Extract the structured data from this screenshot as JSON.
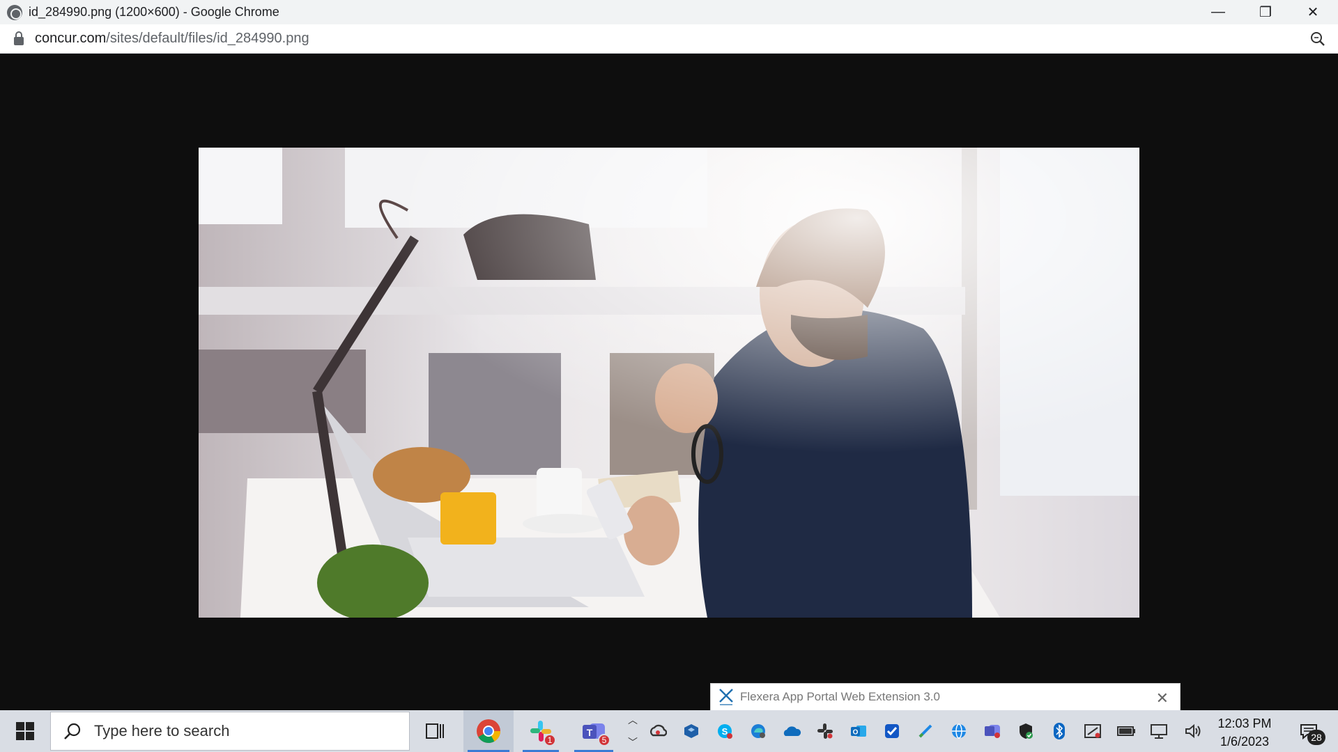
{
  "window": {
    "title": "id_284990.png (1200×600) - Google Chrome",
    "controls": {
      "minimize": "—",
      "maximize": "❐",
      "close": "✕"
    }
  },
  "address": {
    "domain": "concur.com",
    "path": "/sites/default/files/id_284990.png"
  },
  "content": {
    "image_alt": "id_284990.png"
  },
  "notification": {
    "text": "Flexera App Portal Web Extension 3.0",
    "close": "✕"
  },
  "taskbar": {
    "search_placeholder": "Type here to search",
    "apps": [
      {
        "name": "task-view-icon"
      },
      {
        "name": "chrome-icon",
        "active": true
      },
      {
        "name": "slack-icon",
        "badge": "1"
      },
      {
        "name": "teams-icon",
        "badge": "5"
      }
    ],
    "tray_icons": [
      "creative-cloud-icon",
      "virtualbox-icon",
      "skype-icon",
      "edge-icon",
      "onedrive-icon",
      "slack-tray-icon",
      "outlook-icon",
      "checkbox-app-icon",
      "pen-icon",
      "globe-icon",
      "teams-tray-icon",
      "defender-icon",
      "bluetooth-icon",
      "snipping-icon",
      "battery-icon",
      "network-icon",
      "volume-icon"
    ],
    "clock": {
      "time": "12:03 PM",
      "date": "1/6/2023"
    },
    "notifications_count": "28"
  },
  "colors": {
    "accent": "#3a7bd5",
    "badge": "#d13438",
    "page_bg": "#0e0e0e"
  }
}
